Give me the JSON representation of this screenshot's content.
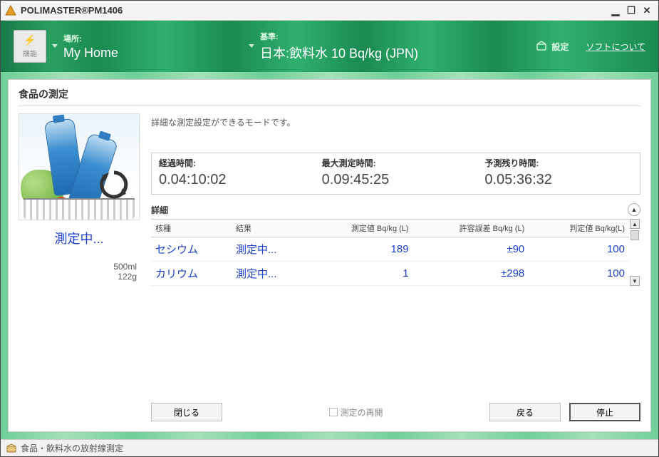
{
  "window": {
    "title": "POLIMASTER®PM1406"
  },
  "header": {
    "func_label": "機能",
    "location_label": "場所:",
    "location_value": "My Home",
    "standard_label": "基準:",
    "standard_value": "日本:飲料水 10 Bq/kg (JPN)",
    "settings_label": "設定",
    "about_label": "ソフトについて"
  },
  "panel": {
    "title": "食品の測定",
    "mode_description": "詳細な測定設定ができるモードです。",
    "status": "測定中...",
    "sample": {
      "volume": "500ml",
      "weight": "122g"
    },
    "times": {
      "elapsed_label": "経過時間:",
      "elapsed_value": "0.04:10:02",
      "max_label": "最大測定時間:",
      "max_value": "0.09:45:25",
      "remain_label": "予測残り時間:",
      "remain_value": "0.05:36:32"
    },
    "details": {
      "label": "詳細",
      "columns": {
        "nuclide": "核種",
        "result": "結果",
        "measured": "測定値 Bq/kg (L)",
        "tolerance": "許容誤差 Bq/kg (L)",
        "threshold": "判定値 Bq/kg(L)"
      },
      "rows": [
        {
          "nuclide": "セシウム",
          "result": "測定中...",
          "measured": "189",
          "tolerance": "±90",
          "threshold": "100"
        },
        {
          "nuclide": "カリウム",
          "result": "測定中...",
          "measured": "1",
          "tolerance": "±298",
          "threshold": "100"
        }
      ]
    },
    "buttons": {
      "close": "閉じる",
      "resume": "測定の再開",
      "back": "戻る",
      "stop": "停止"
    }
  },
  "statusbar": {
    "text": "食品・飲料水の放射線測定"
  }
}
